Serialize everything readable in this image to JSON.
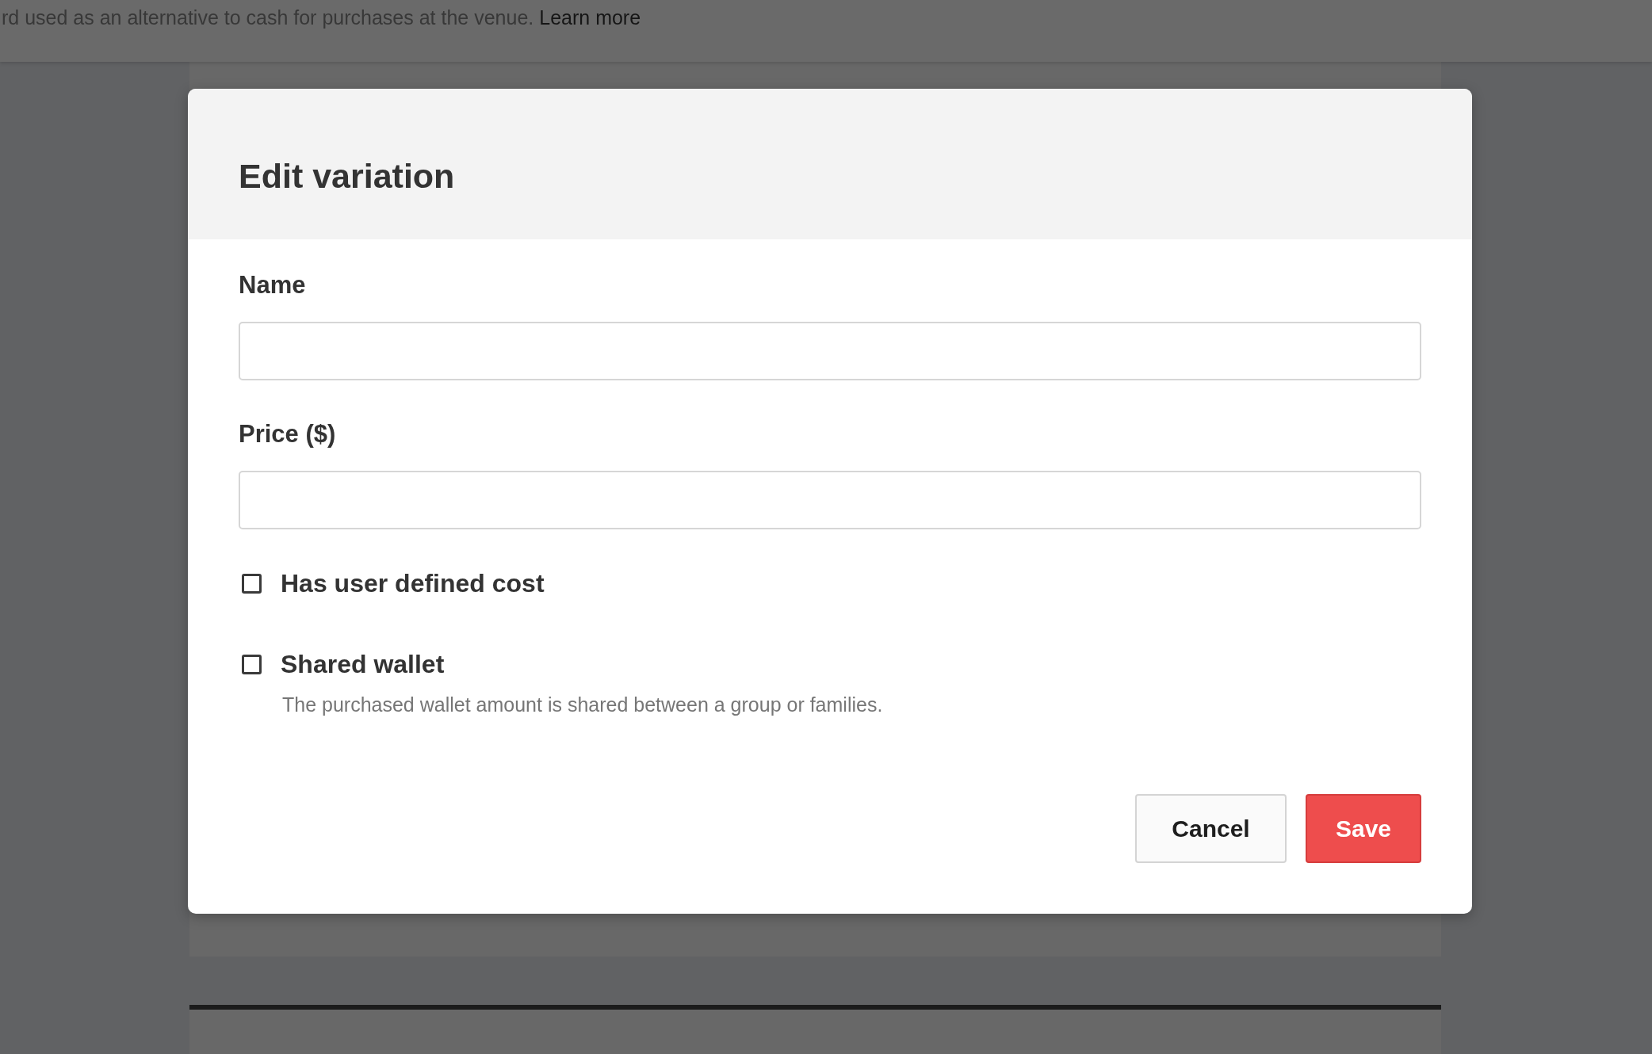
{
  "notice": {
    "text": "rd used as an alternative to cash for purchases at the venue.",
    "link": "Learn more"
  },
  "dialog": {
    "title": "Edit variation",
    "fields": [
      {
        "label": "Name"
      },
      {
        "label": "Price ($)"
      }
    ],
    "checkboxes": [
      {
        "label": "Has user defined cost",
        "checked": false
      },
      {
        "label": "Shared wallet",
        "checked": false,
        "description": "The purchased wallet amount is shared between a group or families."
      }
    ],
    "buttons": [
      {
        "label": "Cancel",
        "kind": "secondary"
      },
      {
        "label": "Save",
        "kind": "primary"
      }
    ]
  }
}
